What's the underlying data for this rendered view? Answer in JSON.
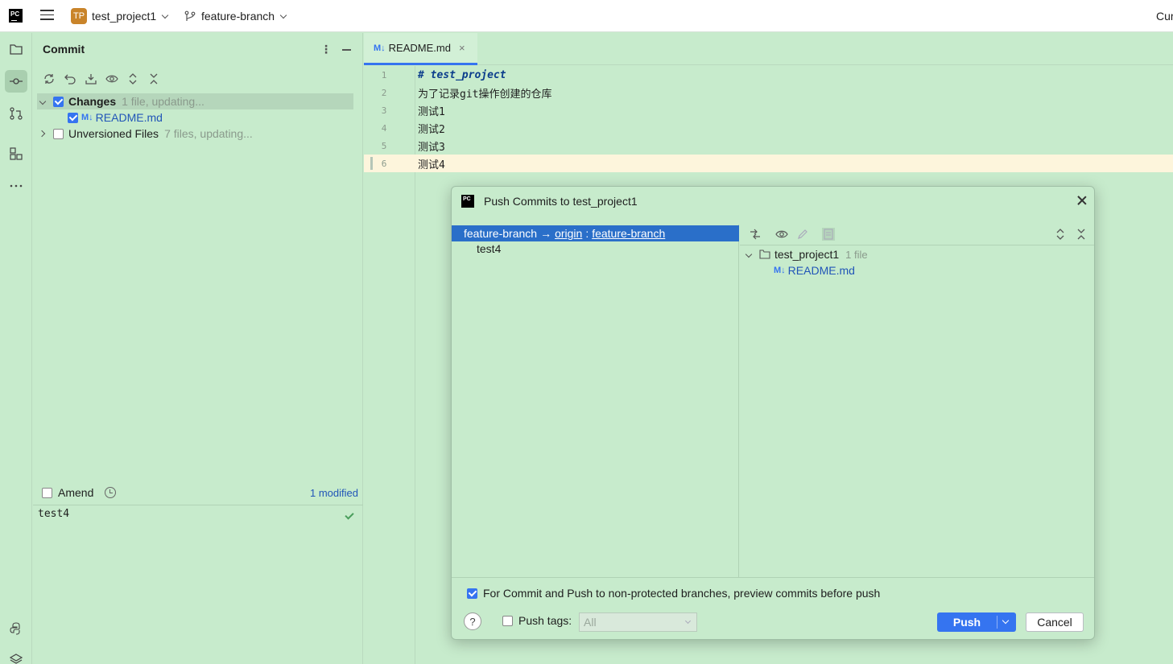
{
  "titlebar": {
    "project_badge": "TP",
    "project_name": "test_project1",
    "branch_name": "feature-branch",
    "right_cut_text": "Cur"
  },
  "toolstrip": {
    "items": [
      "project-icon",
      "commit-icon",
      "pull-requests-icon",
      "structure-icon",
      "more-icon",
      "python-console-icon",
      "layers-icon"
    ]
  },
  "commit_panel": {
    "title": "Commit",
    "changes_label": "Changes",
    "changes_meta": "1 file, updating...",
    "file_badge": "M↓",
    "file_name": "README.md",
    "unversioned_label": "Unversioned Files",
    "unversioned_meta": "7 files, updating...",
    "amend_label": "Amend",
    "modified_link": "1 modified",
    "commit_message": "test4"
  },
  "editor": {
    "tab_badge": "M↓",
    "tab_label": "README.md",
    "tab_close": "×",
    "lines": [
      {
        "num": "1",
        "text": "# test_project"
      },
      {
        "num": "2",
        "text": "为了记录git操作创建的仓库"
      },
      {
        "num": "3",
        "text": "测试1"
      },
      {
        "num": "4",
        "text": "测试2"
      },
      {
        "num": "5",
        "text": "测试3"
      },
      {
        "num": "6",
        "text": "测试4"
      }
    ]
  },
  "dialog": {
    "logo": "PC",
    "title": "Push Commits to test_project1",
    "branch_local": "feature-branch",
    "arrow": "→",
    "remote": "origin",
    "colon": ":",
    "branch_remote": "feature-branch",
    "commit": "test4",
    "tree_root": "test_project1",
    "tree_root_meta": "1 file",
    "tree_file_badge": "M↓",
    "tree_file": "README.md",
    "preview_label": "For Commit and Push to non-protected branches, preview commits before push",
    "help": "?",
    "push_tags_label": "Push tags:",
    "push_tags_value": "All",
    "push_button": "Push",
    "cancel_button": "Cancel"
  },
  "colors": {
    "accent": "#3574f0",
    "background": "#c7ebcc",
    "selection": "#2a6fc9",
    "current_line": "#fdf5dc"
  }
}
